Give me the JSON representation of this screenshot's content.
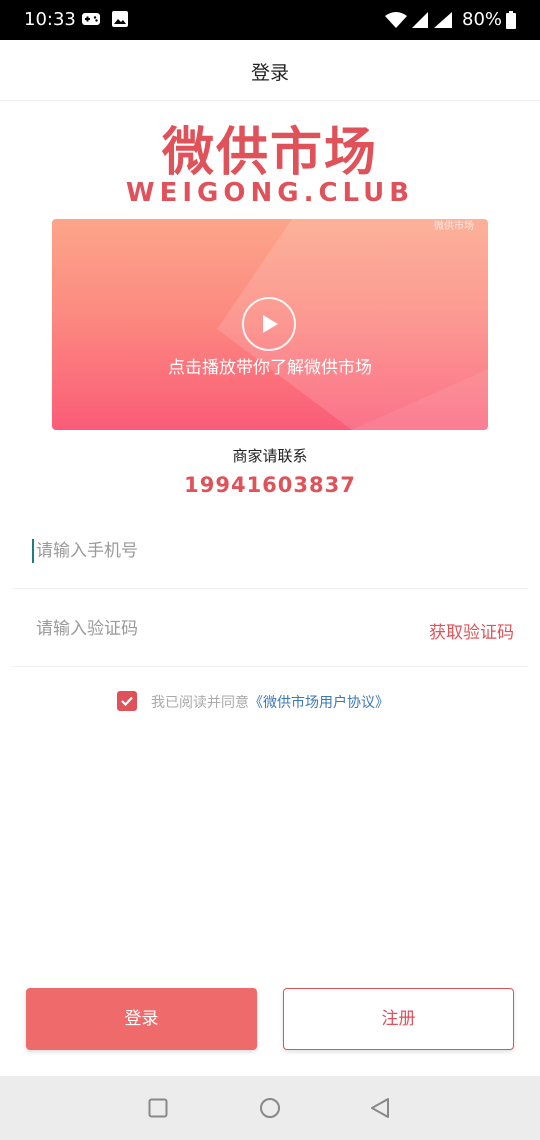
{
  "status_bar": {
    "time": "10:33",
    "battery": "80%"
  },
  "header": {
    "title": "登录"
  },
  "logo": {
    "name_cn": "微供市场",
    "name_en": "WEIGONG.CLUB"
  },
  "banner": {
    "caption": "点击播放带你了解微供市场",
    "corner_watermark": "微供市场"
  },
  "contact": {
    "label": "商家请联系",
    "phone": "19941603837"
  },
  "form": {
    "phone_placeholder": "请输入手机号",
    "code_placeholder": "请输入验证码",
    "get_code_label": "获取验证码"
  },
  "agreement": {
    "prefix": "我已阅读并同意",
    "link": "《微供市场用户协议》",
    "checked": true
  },
  "buttons": {
    "login": "登录",
    "register": "注册"
  },
  "colors": {
    "brand": "#e0525a",
    "login_button": "#ef6b6b",
    "link": "#3a78b8"
  }
}
